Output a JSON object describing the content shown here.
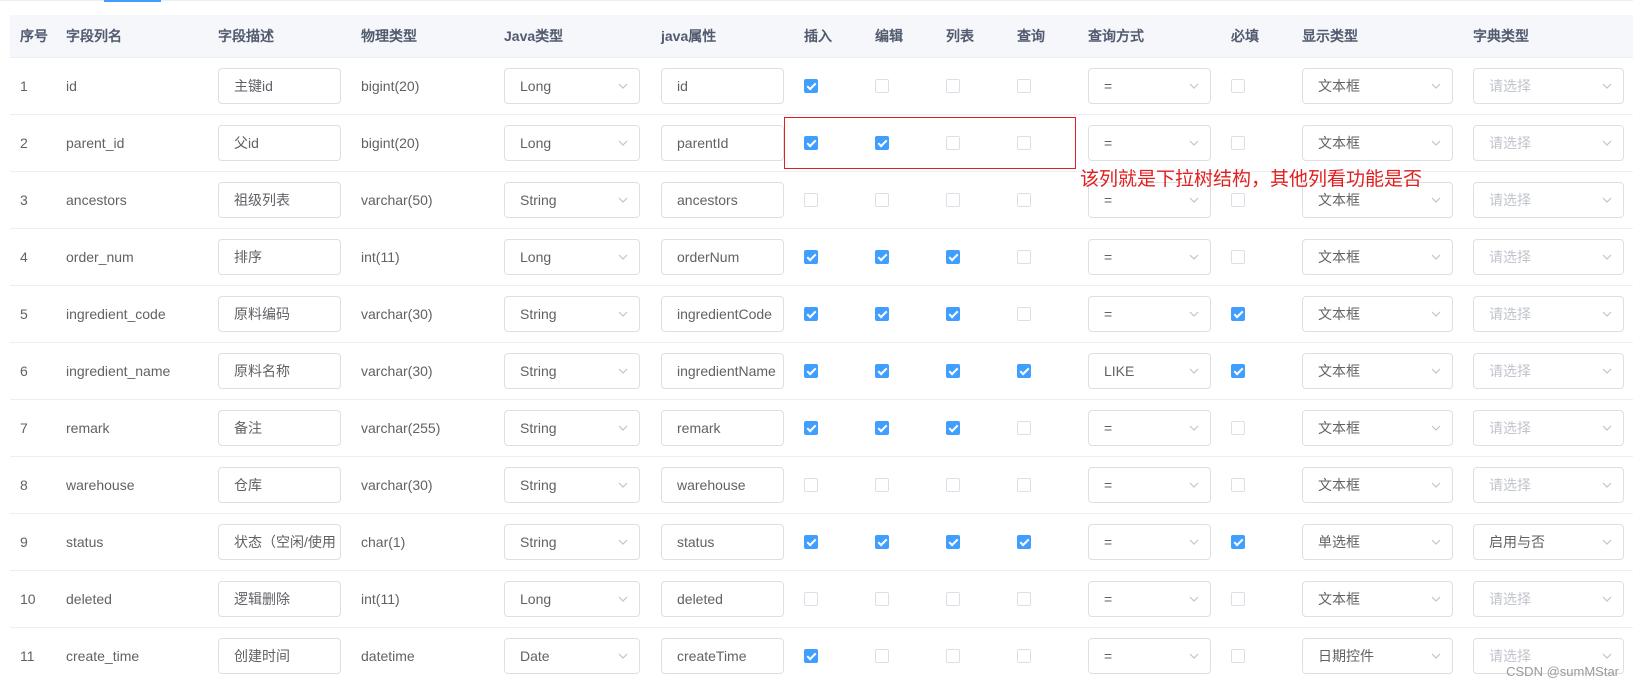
{
  "colors": {
    "accent": "#409eff",
    "annotation": "#e02020",
    "border": "#dcdfe6"
  },
  "headers": {
    "index": "序号",
    "column_name": "字段列名",
    "description": "字段描述",
    "physical_type": "物理类型",
    "java_type": "Java类型",
    "java_field": "java属性",
    "insert": "插入",
    "edit": "编辑",
    "list": "列表",
    "query": "查询",
    "query_type": "查询方式",
    "required": "必填",
    "html_type": "显示类型",
    "dict_type": "字典类型"
  },
  "rows": [
    {
      "index": "1",
      "column": "id",
      "desc": "主键id",
      "phys": "bigint(20)",
      "java": "Long",
      "field": "id",
      "insert": true,
      "edit": false,
      "list": false,
      "query": false,
      "qtype": "=",
      "required": false,
      "html": "文本框",
      "dict": "请选择",
      "dict_placeholder": true
    },
    {
      "index": "2",
      "column": "parent_id",
      "desc": "父id",
      "phys": "bigint(20)",
      "java": "Long",
      "field": "parentId",
      "insert": true,
      "edit": true,
      "list": false,
      "query": false,
      "qtype": "=",
      "required": false,
      "html": "文本框",
      "dict": "请选择",
      "dict_placeholder": true
    },
    {
      "index": "3",
      "column": "ancestors",
      "desc": "祖级列表",
      "phys": "varchar(50)",
      "java": "String",
      "field": "ancestors",
      "insert": false,
      "edit": false,
      "list": false,
      "query": false,
      "qtype": "=",
      "required": false,
      "html": "文本框",
      "dict": "请选择",
      "dict_placeholder": true
    },
    {
      "index": "4",
      "column": "order_num",
      "desc": "排序",
      "phys": "int(11)",
      "java": "Long",
      "field": "orderNum",
      "insert": true,
      "edit": true,
      "list": true,
      "query": false,
      "qtype": "=",
      "required": false,
      "html": "文本框",
      "dict": "请选择",
      "dict_placeholder": true
    },
    {
      "index": "5",
      "column": "ingredient_code",
      "desc": "原料编码",
      "phys": "varchar(30)",
      "java": "String",
      "field": "ingredientCode",
      "insert": true,
      "edit": true,
      "list": true,
      "query": false,
      "qtype": "=",
      "required": true,
      "html": "文本框",
      "dict": "请选择",
      "dict_placeholder": true
    },
    {
      "index": "6",
      "column": "ingredient_name",
      "desc": "原料名称",
      "phys": "varchar(30)",
      "java": "String",
      "field": "ingredientName",
      "insert": true,
      "edit": true,
      "list": true,
      "query": true,
      "qtype": "LIKE",
      "required": true,
      "html": "文本框",
      "dict": "请选择",
      "dict_placeholder": true
    },
    {
      "index": "7",
      "column": "remark",
      "desc": "备注",
      "phys": "varchar(255)",
      "java": "String",
      "field": "remark",
      "insert": true,
      "edit": true,
      "list": true,
      "query": false,
      "qtype": "=",
      "required": false,
      "html": "文本框",
      "dict": "请选择",
      "dict_placeholder": true
    },
    {
      "index": "8",
      "column": "warehouse",
      "desc": "仓库",
      "phys": "varchar(30)",
      "java": "String",
      "field": "warehouse",
      "insert": false,
      "edit": false,
      "list": false,
      "query": false,
      "qtype": "=",
      "required": false,
      "html": "文本框",
      "dict": "请选择",
      "dict_placeholder": true
    },
    {
      "index": "9",
      "column": "status",
      "desc": "状态（空闲/使用",
      "phys": "char(1)",
      "java": "String",
      "field": "status",
      "insert": true,
      "edit": true,
      "list": true,
      "query": true,
      "qtype": "=",
      "required": true,
      "html": "单选框",
      "dict": "启用与否",
      "dict_placeholder": false
    },
    {
      "index": "10",
      "column": "deleted",
      "desc": "逻辑删除",
      "phys": "int(11)",
      "java": "Long",
      "field": "deleted",
      "insert": false,
      "edit": false,
      "list": false,
      "query": false,
      "qtype": "=",
      "required": false,
      "html": "文本框",
      "dict": "请选择",
      "dict_placeholder": true
    },
    {
      "index": "11",
      "column": "create_time",
      "desc": "创建时间",
      "phys": "datetime",
      "java": "Date",
      "field": "createTime",
      "insert": true,
      "edit": false,
      "list": false,
      "query": false,
      "qtype": "=",
      "required": false,
      "html": "日期控件",
      "dict": "请选择",
      "dict_placeholder": true
    }
  ],
  "annotation": {
    "text": "该列就是下拉树结构，其他列看功能是否"
  },
  "watermark": "CSDN @sumMStar",
  "icons": {
    "select_arrow": "chevron-down-icon"
  }
}
